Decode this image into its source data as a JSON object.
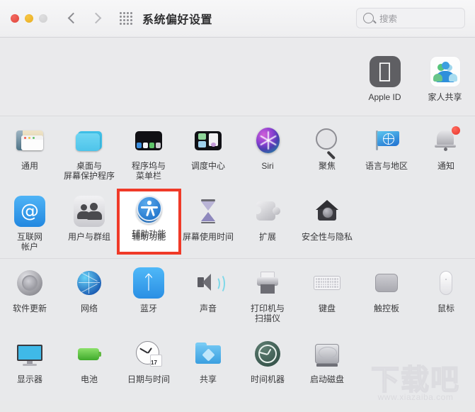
{
  "window": {
    "title": "系统偏好设置",
    "traffic_lights": [
      "close",
      "minimize",
      "zoom"
    ]
  },
  "toolbar": {
    "back_label": "后退",
    "forward_label": "前进",
    "grid_label": "显示全部",
    "search": {
      "placeholder": "搜索",
      "value": ""
    }
  },
  "accent": {
    "highlight_border": "#f03a28",
    "accessibility_blue": "#1569c4",
    "notification_badge": "#e8332a"
  },
  "sections": [
    {
      "name": "account",
      "items": [
        {
          "label": "Apple ID",
          "icon": "apple-id-icon"
        },
        {
          "label": "家人共享",
          "icon": "family-sharing-icon"
        }
      ]
    },
    {
      "name": "personal",
      "items": [
        {
          "label": "通用",
          "icon": "general-icon"
        },
        {
          "label": "桌面与\n屏幕保护程序",
          "icon": "desktop-screensaver-icon"
        },
        {
          "label": "程序坞与\n菜单栏",
          "icon": "dock-menubar-icon"
        },
        {
          "label": "调度中心",
          "icon": "mission-control-icon"
        },
        {
          "label": "Siri",
          "icon": "siri-icon"
        },
        {
          "label": "聚焦",
          "icon": "spotlight-icon"
        },
        {
          "label": "语言与地区",
          "icon": "language-region-icon"
        },
        {
          "label": "通知",
          "icon": "notifications-icon"
        },
        {
          "label": "互联网\n帐户",
          "icon": "internet-accounts-icon"
        },
        {
          "label": "用户与群组",
          "icon": "users-groups-icon"
        },
        {
          "label": "辅助功能",
          "icon": "accessibility-icon",
          "highlighted": true
        },
        {
          "label": "屏幕使用时间",
          "icon": "screen-time-icon"
        },
        {
          "label": "扩展",
          "icon": "extensions-icon"
        },
        {
          "label": "安全性与隐私",
          "icon": "security-privacy-icon"
        }
      ]
    },
    {
      "name": "hardware",
      "items": [
        {
          "label": "软件更新",
          "icon": "software-update-icon"
        },
        {
          "label": "网络",
          "icon": "network-icon"
        },
        {
          "label": "蓝牙",
          "icon": "bluetooth-icon"
        },
        {
          "label": "声音",
          "icon": "sound-icon"
        },
        {
          "label": "打印机与\n扫描仪",
          "icon": "printers-scanners-icon"
        },
        {
          "label": "键盘",
          "icon": "keyboard-icon"
        },
        {
          "label": "触控板",
          "icon": "trackpad-icon"
        },
        {
          "label": "鼠标",
          "icon": "mouse-icon"
        },
        {
          "label": "显示器",
          "icon": "displays-icon"
        },
        {
          "label": "电池",
          "icon": "battery-icon"
        },
        {
          "label": "日期与时间",
          "icon": "date-time-icon",
          "badge": "17"
        },
        {
          "label": "共享",
          "icon": "sharing-icon"
        },
        {
          "label": "时间机器",
          "icon": "time-machine-icon"
        },
        {
          "label": "启动磁盘",
          "icon": "startup-disk-icon"
        }
      ]
    }
  ],
  "watermark": {
    "text": "下载吧",
    "url": "www.xiazaiba.com"
  }
}
